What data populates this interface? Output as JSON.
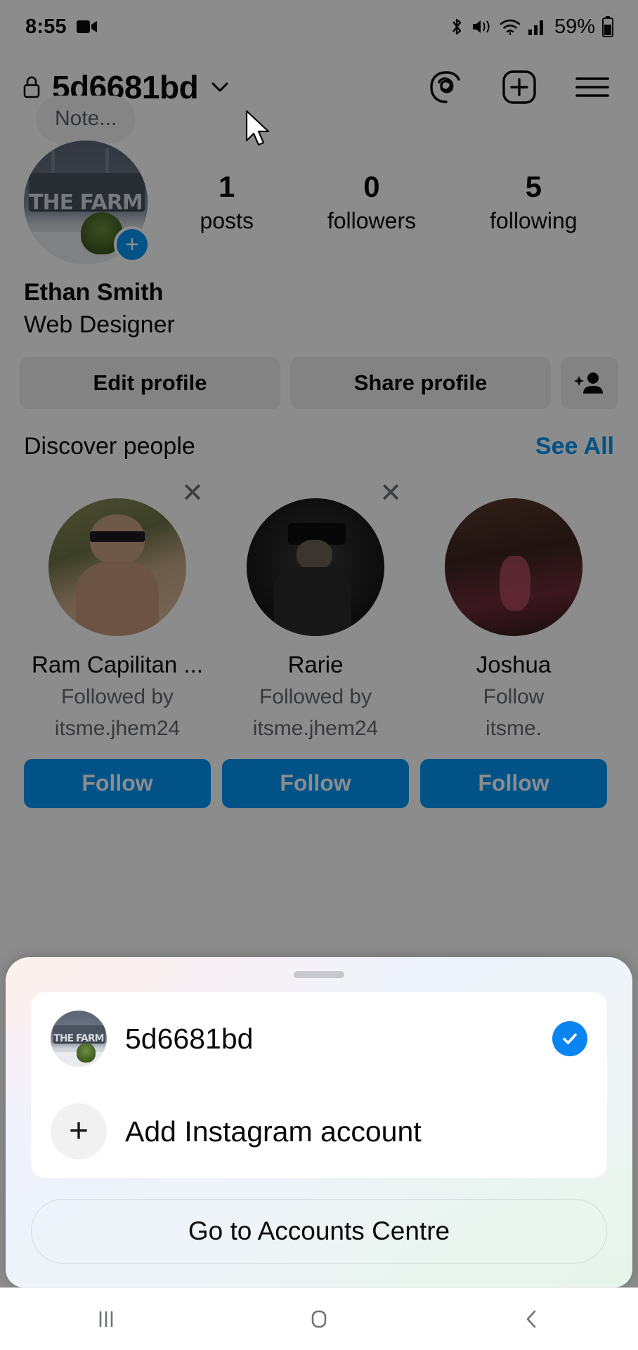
{
  "status_bar": {
    "time": "8:55",
    "battery_percent": "59%",
    "icons": [
      "video-recording-icon",
      "bluetooth-icon",
      "mute-vibrate-icon",
      "wifi-icon",
      "cellular-signal-icon",
      "battery-icon"
    ]
  },
  "profile": {
    "username": "5d6681bd",
    "lock_icon": "lock-icon",
    "chevron": "chevron-down-icon",
    "header_actions": [
      "threads-icon",
      "new-post-icon",
      "menu-icon"
    ],
    "note_text": "Note...",
    "avatar_sign_text": "THE FARM",
    "stats": [
      {
        "value": "1",
        "label": "posts"
      },
      {
        "value": "0",
        "label": "followers"
      },
      {
        "value": "5",
        "label": "following"
      }
    ],
    "display_name": "Ethan Smith",
    "bio": "Web Designer",
    "buttons": {
      "edit_profile": "Edit profile",
      "share_profile": "Share profile",
      "discover_people_icon": "add-person-icon"
    }
  },
  "discover": {
    "title": "Discover people",
    "see_all": "See All",
    "follow_label": "Follow",
    "close_icon": "close-icon",
    "cards": [
      {
        "name": "Ram Capilitan ...",
        "followed_by_line1": "Followed by",
        "followed_by_line2": "itsme.jhem24"
      },
      {
        "name": "Rarie",
        "followed_by_line1": "Followed by",
        "followed_by_line2": "itsme.jhem24"
      },
      {
        "name": "Joshua ",
        "followed_by_line1": "Follow",
        "followed_by_line2": "itsme."
      }
    ]
  },
  "account_sheet": {
    "grabber": "drag-handle",
    "accounts": [
      {
        "name": "5d6681bd",
        "selected": true,
        "check_icon": "check-icon"
      }
    ],
    "add_account_label": "Add Instagram account",
    "add_account_icon": "plus-icon",
    "accounts_centre_label": "Go to Accounts Centre"
  },
  "nav_bar": {
    "recents": "recents-icon",
    "home": "home-icon",
    "back": "back-icon"
  },
  "colors": {
    "instagram_blue": "#0095f6",
    "check_blue": "#0a84f0",
    "link_blue": "#0095f6",
    "scrim": "rgba(0,0,0,0.45)"
  }
}
